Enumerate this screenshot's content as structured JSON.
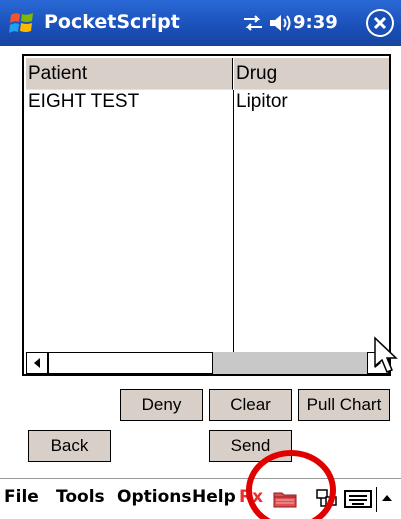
{
  "titlebar": {
    "app_title": "PocketScript",
    "clock": "9:39",
    "icons": [
      "windows-logo-icon",
      "sync-icon",
      "speaker-icon",
      "close-icon"
    ]
  },
  "list": {
    "columns": [
      "Patient",
      "Drug"
    ],
    "rows": [
      [
        "EIGHT TEST",
        "Lipitor"
      ]
    ]
  },
  "buttons": {
    "deny": "Deny",
    "clear": "Clear",
    "pull_chart": "Pull Chart",
    "back": "Back",
    "send": "Send"
  },
  "menubar": {
    "file": "File",
    "tools": "Tools",
    "options": "Options",
    "help": "Help",
    "rx": "Rx",
    "icons": [
      "folder-icon",
      "network-icon",
      "keyboard-icon",
      "sip-arrow-icon"
    ]
  },
  "colors": {
    "titlebar": "#1a4fb8",
    "button_face": "#d8d0c8",
    "rx_red": "#e83030",
    "highlight": "#e00000"
  }
}
